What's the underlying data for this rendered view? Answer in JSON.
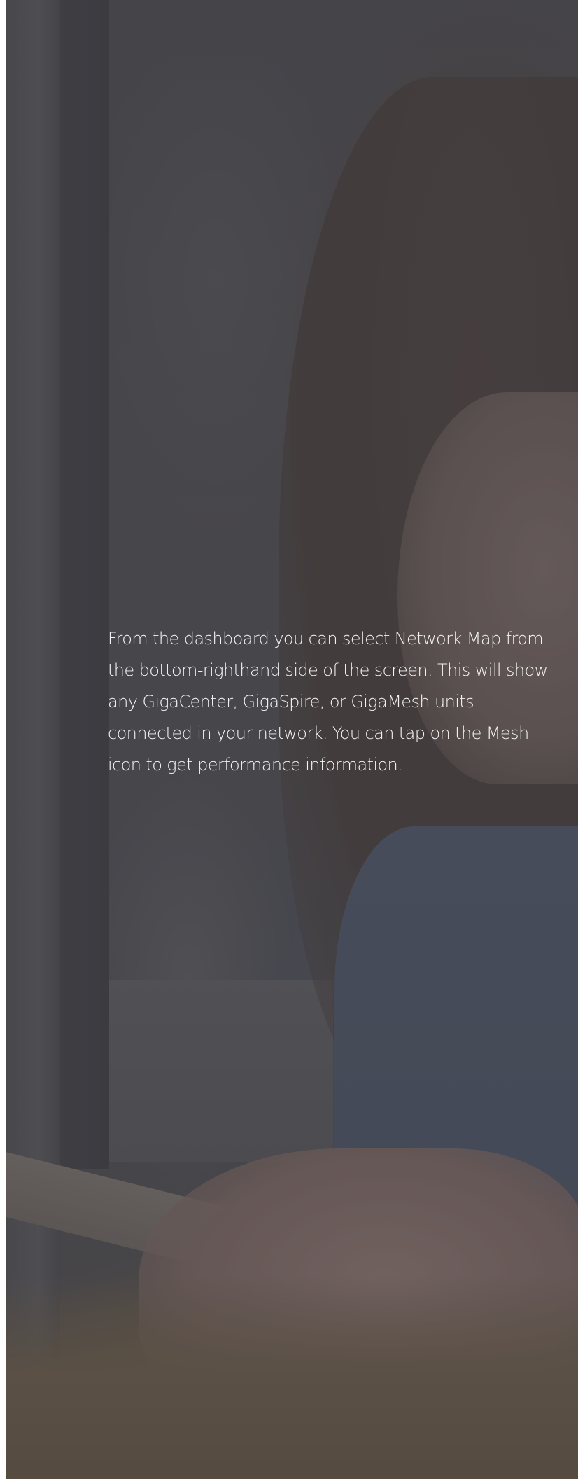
{
  "hero": {
    "body_text": "From the dashboard you can select Network Map from the bottom-righthand side of the screen. This will show any GigaCenter, GigaSpire, or GigaMesh units connected in your network. You can tap on the Mesh icon to get performance information."
  },
  "colors": {
    "overlay": "#4b4a4e",
    "text": "#f2f1f3"
  }
}
